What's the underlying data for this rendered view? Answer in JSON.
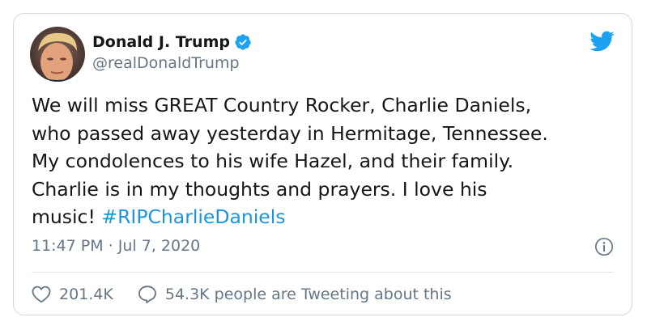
{
  "author": {
    "display_name": "Donald J. Trump",
    "handle": "@realDonaldTrump",
    "verified": true
  },
  "tweet": {
    "lines": [
      "We will miss GREAT Country Rocker, Charlie Daniels,",
      "who passed away yesterday in Hermitage, Tennessee.",
      "My condolences to his wife Hazel, and their family.",
      "Charlie is in my thoughts and prayers. I love his"
    ],
    "last_line_text": "music! ",
    "hashtag": "#RIPCharlieDaniels",
    "timestamp": "11:47 PM · Jul 7, 2020"
  },
  "engagement": {
    "likes": "201.4K",
    "conversation": "54.3K people are Tweeting about this"
  },
  "icons": {
    "brand": "twitter-bird-icon",
    "verified": "verified-badge-icon",
    "info": "info-icon",
    "like": "heart-icon",
    "reply": "speech-bubble-icon"
  },
  "colors": {
    "text": "#14171a",
    "muted": "#657786",
    "accent": "#1da1f2",
    "hashtag": "#1b95e0",
    "border": "#cfd9de"
  }
}
